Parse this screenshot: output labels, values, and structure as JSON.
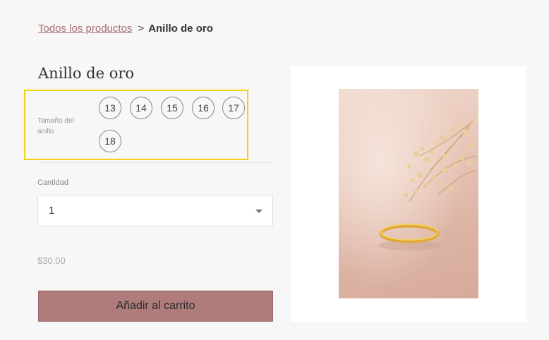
{
  "breadcrumb": {
    "link": "Todos los productos",
    "separator": ">",
    "current": "Anillo de oro"
  },
  "product": {
    "title": "Anillo de oro",
    "price": "$30.00"
  },
  "size": {
    "label": "Tamaño del anillo",
    "options": [
      "13",
      "14",
      "15",
      "16",
      "17",
      "18"
    ]
  },
  "quantity": {
    "label": "Cantidad",
    "value": "1"
  },
  "cart": {
    "add_label": "Añadir al carrito"
  },
  "colors": {
    "accent": "#b07b7b",
    "link": "#a96f6f",
    "highlight": "#f2d21b"
  }
}
